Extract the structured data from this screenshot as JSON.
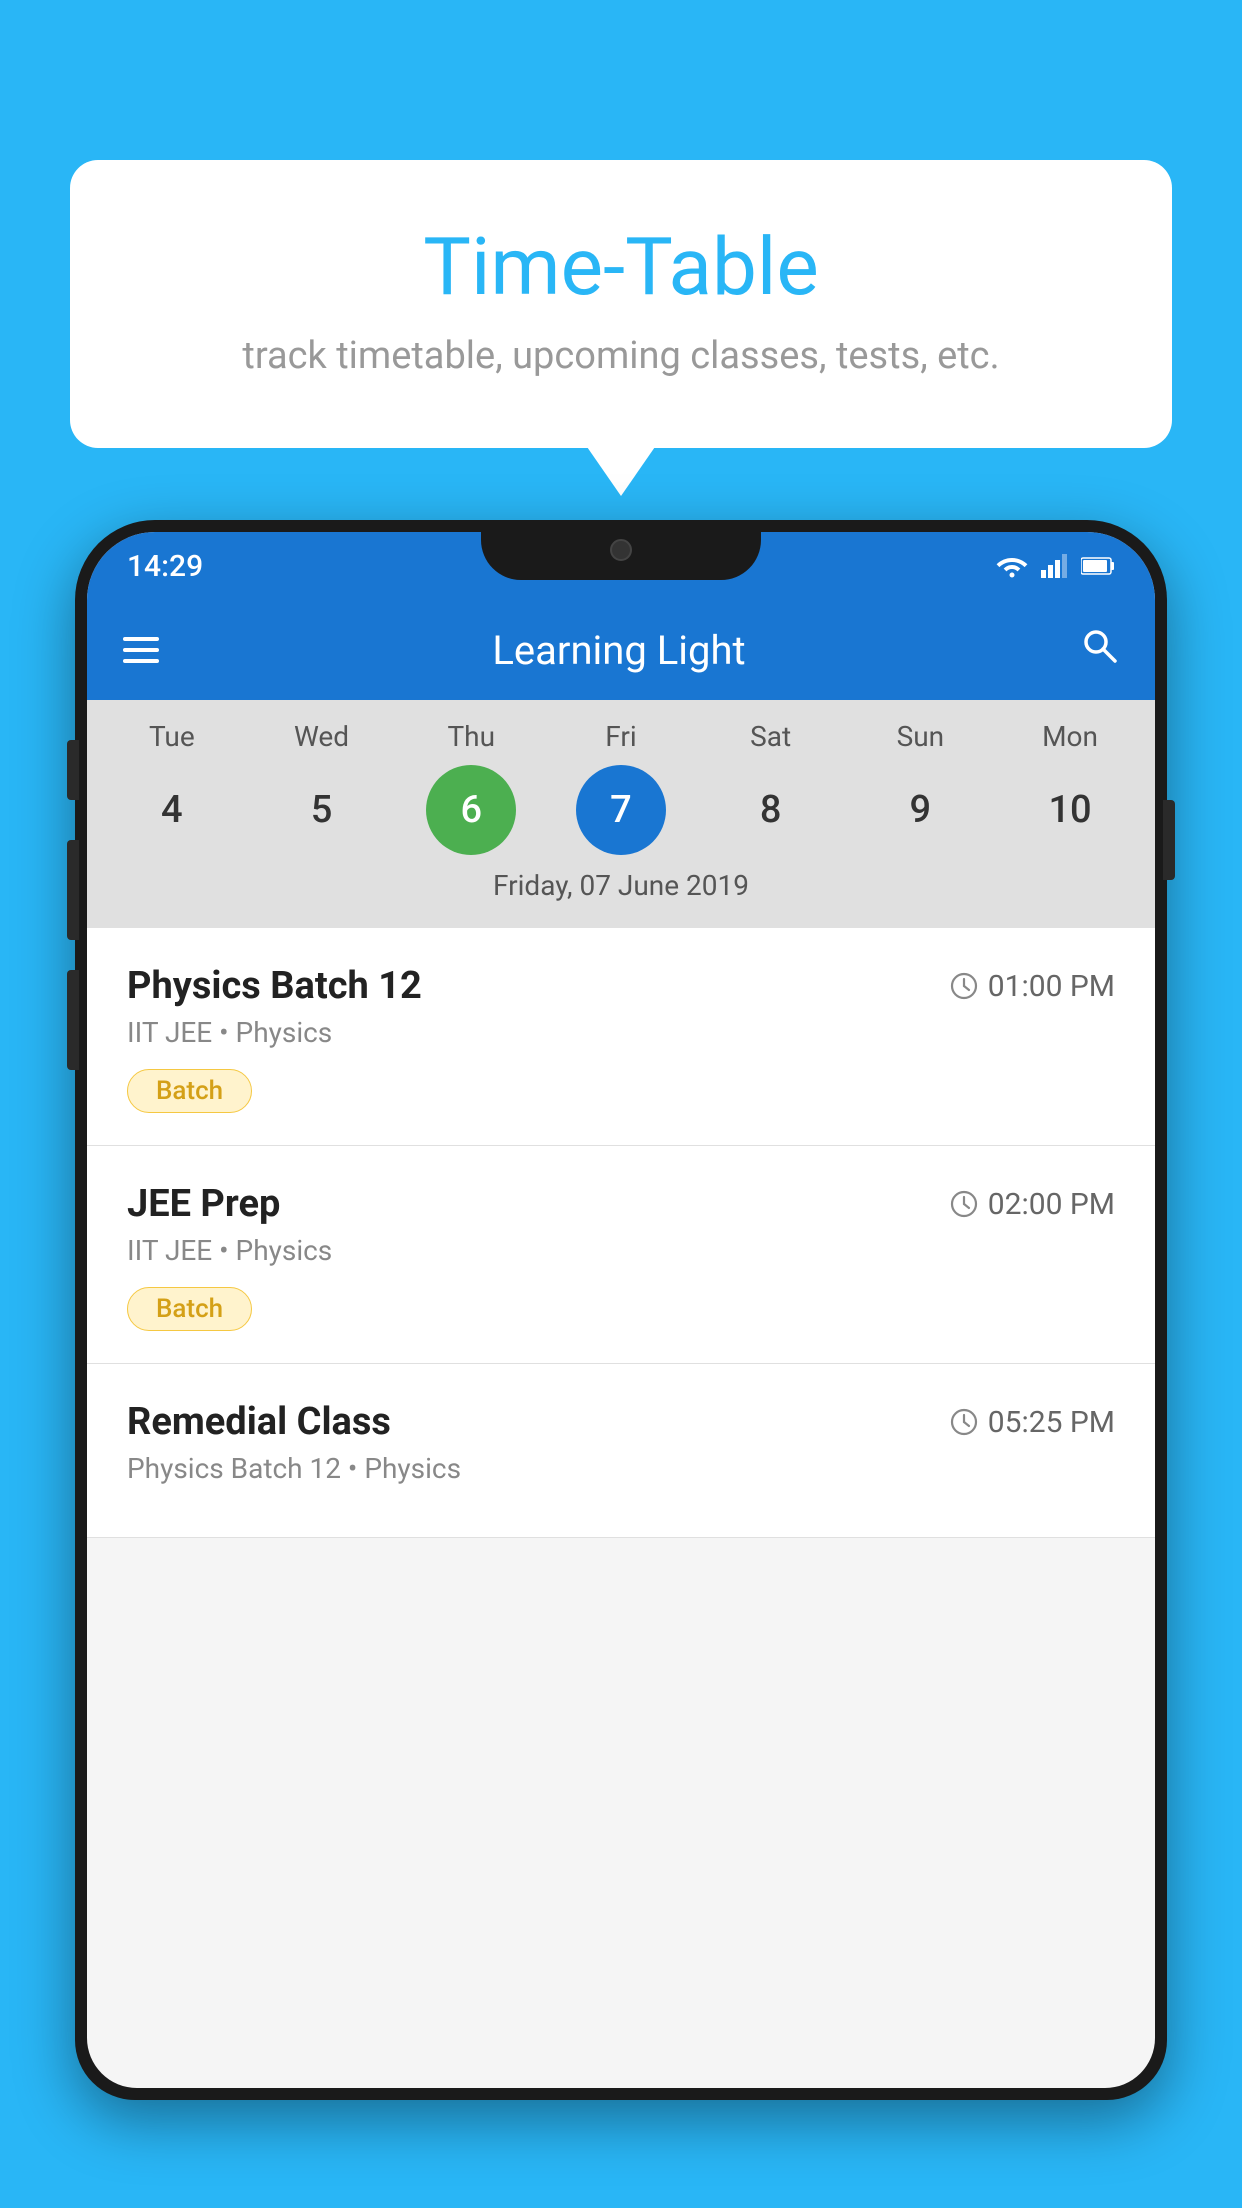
{
  "background_color": "#29B6F6",
  "bubble": {
    "title": "Time-Table",
    "subtitle": "track timetable, upcoming classes, tests, etc."
  },
  "phone": {
    "status_bar": {
      "time": "14:29"
    },
    "toolbar": {
      "title": "Learning Light"
    },
    "calendar": {
      "days": [
        {
          "label": "Tue",
          "number": "4",
          "state": "normal"
        },
        {
          "label": "Wed",
          "number": "5",
          "state": "normal"
        },
        {
          "label": "Thu",
          "number": "6",
          "state": "today"
        },
        {
          "label": "Fri",
          "number": "7",
          "state": "selected"
        },
        {
          "label": "Sat",
          "number": "8",
          "state": "normal"
        },
        {
          "label": "Sun",
          "number": "9",
          "state": "normal"
        },
        {
          "label": "Mon",
          "number": "10",
          "state": "normal"
        }
      ],
      "selected_date_label": "Friday, 07 June 2019"
    },
    "classes": [
      {
        "name": "Physics Batch 12",
        "time": "01:00 PM",
        "subject": "IIT JEE • Physics",
        "badge": "Batch"
      },
      {
        "name": "JEE Prep",
        "time": "02:00 PM",
        "subject": "IIT JEE • Physics",
        "badge": "Batch"
      },
      {
        "name": "Remedial Class",
        "time": "05:25 PM",
        "subject": "Physics Batch 12 • Physics",
        "badge": null
      }
    ]
  }
}
